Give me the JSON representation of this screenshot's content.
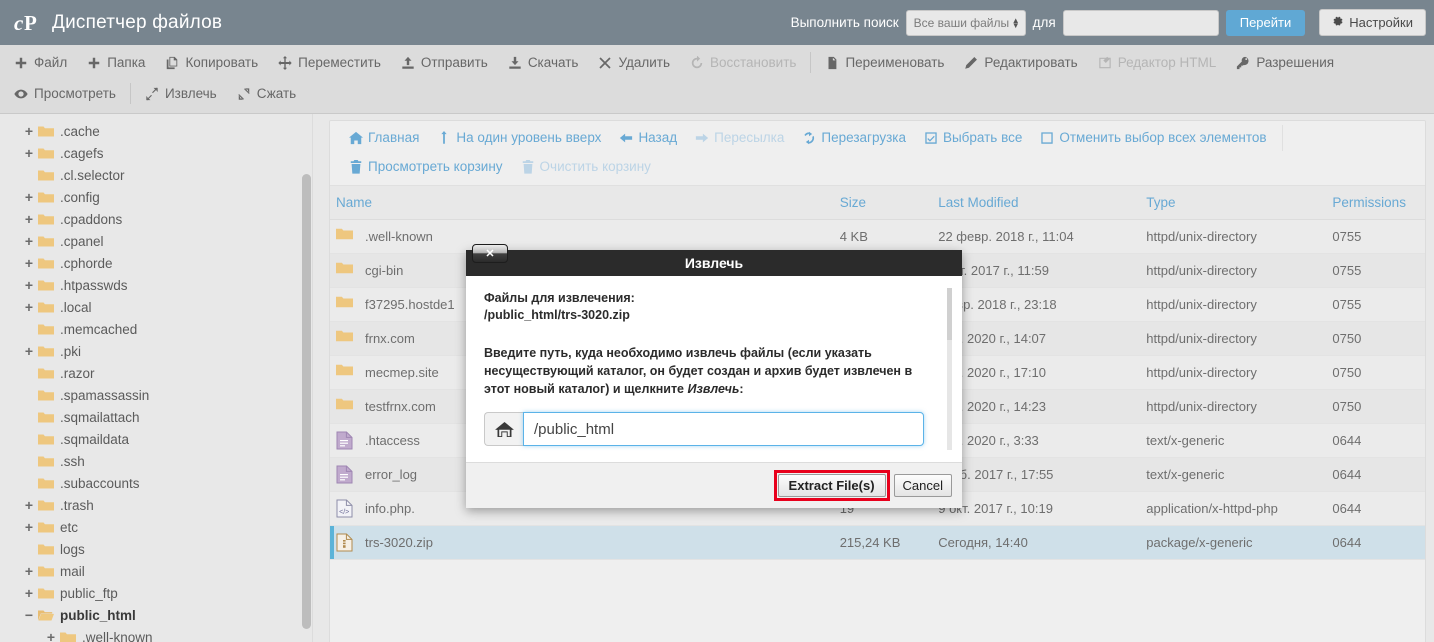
{
  "header": {
    "logo_icon": "cpanel-logo-icon",
    "title": "Диспетчер файлов",
    "search_label": "Выполнить поиск",
    "search_scope": "Все ваши файлы",
    "search_for_label": "для",
    "search_value": "",
    "search_placeholder": "",
    "go_label": "Перейти",
    "settings_label": "Настройки",
    "settings_icon": "gear-icon",
    "bg_color": "#78858f",
    "go_button_color": "#60a8d4"
  },
  "toolbar": {
    "row1": [
      {
        "label": "Файл",
        "icon": "plus-icon",
        "disabled": false
      },
      {
        "label": "Папка",
        "icon": "plus-icon",
        "disabled": false
      },
      {
        "label": "Копировать",
        "icon": "copy-icon",
        "disabled": false
      },
      {
        "label": "Переместить",
        "icon": "move-icon",
        "disabled": false
      },
      {
        "label": "Отправить",
        "icon": "upload-icon",
        "disabled": false
      },
      {
        "label": "Скачать",
        "icon": "download-icon",
        "disabled": false
      },
      {
        "label": "Удалить",
        "icon": "x-icon",
        "disabled": false
      },
      {
        "label": "Восстановить",
        "icon": "restore-icon",
        "disabled": true
      },
      {
        "label": "Переименовать",
        "icon": "file-icon",
        "disabled": false
      },
      {
        "label": "Редактировать",
        "icon": "pencil-icon",
        "disabled": false
      },
      {
        "label": "Редактор HTML",
        "icon": "html-edit-icon",
        "disabled": true
      },
      {
        "label": "Разрешения",
        "icon": "key-icon",
        "disabled": false
      }
    ],
    "row2": [
      {
        "label": "Просмотреть",
        "icon": "eye-icon",
        "disabled": false
      },
      {
        "label": "Извлечь",
        "icon": "expand-icon",
        "disabled": false
      },
      {
        "label": "Сжать",
        "icon": "collapse-icon",
        "disabled": false
      }
    ]
  },
  "sidebar": {
    "items": [
      {
        "label": ".cache",
        "level": 1,
        "twisty": "+",
        "selected": false
      },
      {
        "label": ".cagefs",
        "level": 1,
        "twisty": "+",
        "selected": false
      },
      {
        "label": ".cl.selector",
        "level": 1,
        "twisty": "",
        "selected": false
      },
      {
        "label": ".config",
        "level": 1,
        "twisty": "+",
        "selected": false
      },
      {
        "label": ".cpaddons",
        "level": 1,
        "twisty": "+",
        "selected": false
      },
      {
        "label": ".cpanel",
        "level": 1,
        "twisty": "+",
        "selected": false
      },
      {
        "label": ".cphorde",
        "level": 1,
        "twisty": "+",
        "selected": false
      },
      {
        "label": ".htpasswds",
        "level": 1,
        "twisty": "+",
        "selected": false
      },
      {
        "label": ".local",
        "level": 1,
        "twisty": "+",
        "selected": false
      },
      {
        "label": ".memcached",
        "level": 1,
        "twisty": "",
        "selected": false
      },
      {
        "label": ".pki",
        "level": 1,
        "twisty": "+",
        "selected": false
      },
      {
        "label": ".razor",
        "level": 1,
        "twisty": "",
        "selected": false
      },
      {
        "label": ".spamassassin",
        "level": 1,
        "twisty": "",
        "selected": false
      },
      {
        "label": ".sqmailattach",
        "level": 1,
        "twisty": "",
        "selected": false
      },
      {
        "label": ".sqmaildata",
        "level": 1,
        "twisty": "",
        "selected": false
      },
      {
        "label": ".ssh",
        "level": 1,
        "twisty": "",
        "selected": false
      },
      {
        "label": ".subaccounts",
        "level": 1,
        "twisty": "",
        "selected": false
      },
      {
        "label": ".trash",
        "level": 1,
        "twisty": "+",
        "selected": false
      },
      {
        "label": "etc",
        "level": 1,
        "twisty": "+",
        "selected": false
      },
      {
        "label": "logs",
        "level": 1,
        "twisty": "",
        "selected": false
      },
      {
        "label": "mail",
        "level": 1,
        "twisty": "+",
        "selected": false
      },
      {
        "label": "public_ftp",
        "level": 1,
        "twisty": "+",
        "selected": false
      },
      {
        "label": "public_html",
        "level": 1,
        "twisty": "−",
        "selected": true
      },
      {
        "label": ".well-known",
        "level": 2,
        "twisty": "+",
        "selected": false
      }
    ]
  },
  "navbar": {
    "row1": [
      {
        "label": "Главная",
        "icon": "home-icon",
        "disabled": false
      },
      {
        "label": "На один уровень вверх",
        "icon": "up-arrow-icon",
        "disabled": false
      },
      {
        "label": "Назад",
        "icon": "left-arrow-icon",
        "disabled": false
      },
      {
        "label": "Пересылка",
        "icon": "right-arrow-icon",
        "disabled": true
      },
      {
        "label": "Перезагрузка",
        "icon": "refresh-icon",
        "disabled": false
      },
      {
        "label": "Выбрать все",
        "icon": "checkbox-checked-icon",
        "disabled": false
      },
      {
        "label": "Отменить выбор всех элементов",
        "icon": "checkbox-empty-icon",
        "disabled": false
      }
    ],
    "row2": [
      {
        "label": "Просмотреть корзину",
        "icon": "trash-icon",
        "disabled": false
      },
      {
        "label": "Очистить корзину",
        "icon": "trash-icon",
        "disabled": true
      }
    ]
  },
  "table": {
    "columns": [
      "Name",
      "Size",
      "Last Modified",
      "Type",
      "Permissions"
    ],
    "rows": [
      {
        "icon": "folder-icon",
        "name": ".well-known",
        "size": "4 KB",
        "modified": "22 февр. 2018 г., 11:04",
        "type": "httpd/unix-directory",
        "perm": "0755",
        "selected": false
      },
      {
        "icon": "folder-icon",
        "name": "cgi-bin",
        "size": "",
        "modified": "сент. 2017 г., 11:59",
        "type": "httpd/unix-directory",
        "perm": "0755",
        "selected": false
      },
      {
        "icon": "folder-icon",
        "name": "f37295.hostde1",
        "size": "",
        "modified": "февр. 2018 г., 23:18",
        "type": "httpd/unix-directory",
        "perm": "0755",
        "selected": false
      },
      {
        "icon": "folder-icon",
        "name": "frnx.com",
        "size": "",
        "modified": "апр. 2020 г., 14:07",
        "type": "httpd/unix-directory",
        "perm": "0750",
        "selected": false
      },
      {
        "icon": "folder-icon",
        "name": "mecmep.site",
        "size": "",
        "modified": "апр. 2020 г., 17:10",
        "type": "httpd/unix-directory",
        "perm": "0750",
        "selected": false
      },
      {
        "icon": "folder-icon",
        "name": "testfrnx.com",
        "size": "",
        "modified": "апр. 2020 г., 14:23",
        "type": "httpd/unix-directory",
        "perm": "0750",
        "selected": false
      },
      {
        "icon": "text-file-icon",
        "name": ".htaccess",
        "size": "",
        "modified": "апр. 2020 г., 3:33",
        "type": "text/x-generic",
        "perm": "0644",
        "selected": false
      },
      {
        "icon": "text-file-icon",
        "name": "error_log",
        "size": "",
        "modified": "нояб. 2017 г., 17:55",
        "type": "text/x-generic",
        "perm": "0644",
        "selected": false
      },
      {
        "icon": "php-file-icon",
        "name": "info.php.",
        "size": "19",
        "modified": "9 окт. 2017 г., 10:19",
        "type": "application/x-httpd-php",
        "perm": "0644",
        "selected": false
      },
      {
        "icon": "zip-file-icon",
        "name": "trs-3020.zip",
        "size": "215,24 KB",
        "modified": "Сегодня, 14:40",
        "type": "package/x-generic",
        "perm": "0644",
        "selected": true
      }
    ]
  },
  "modal": {
    "title": "Извлечь",
    "close_icon": "close-icon",
    "files_label": "Файлы для извлечения:",
    "files_path": "/public_html/trs-3020.zip",
    "instructions_part1": "Введите путь, куда необходимо извлечь файлы (если указать несуществующий каталог, он будет создан и архив будет извлечен в этот новый каталог) и щелкните ",
    "instructions_emphasis": "Извлечь",
    "instructions_part2": ":",
    "home_icon": "home-icon",
    "path_value": "/public_html",
    "path_placeholder": "",
    "extract_label": "Extract File(s)",
    "cancel_label": "Cancel",
    "highlight_color": "#e8001c"
  }
}
